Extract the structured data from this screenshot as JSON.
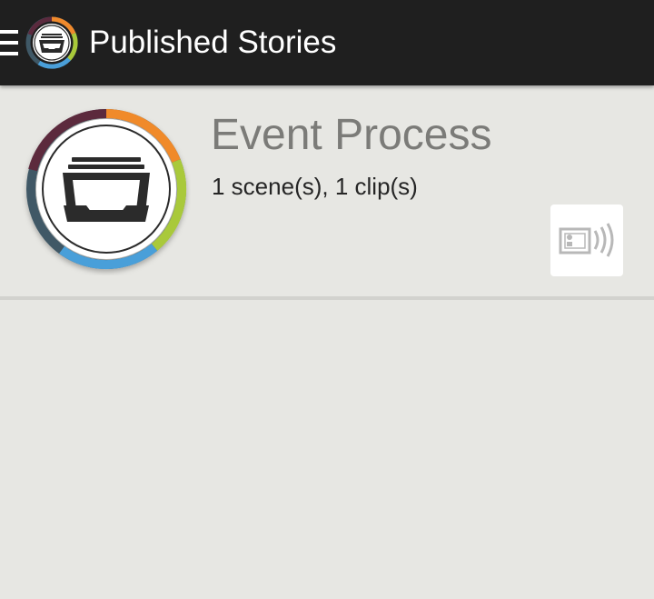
{
  "header": {
    "title": "Published Stories",
    "menu_icon": "hamburger-menu-icon",
    "logo_icon": "story-archive-logo-icon"
  },
  "stories": [
    {
      "title": "Event Process",
      "meta": "1 scene(s), 1 clip(s)",
      "thumbnail_icon": "story-archive-icon",
      "action_icon": "present-slideshow-icon"
    }
  ],
  "colors": {
    "action_bar": "#1f1f1f",
    "background": "#e7e7e3",
    "title_text": "#7b7b78",
    "ring_orange": "#f08a2c",
    "ring_green": "#a9c93a",
    "ring_blue": "#4a9fd9",
    "ring_slate": "#3f5866",
    "ring_plum": "#5b2a3e"
  }
}
